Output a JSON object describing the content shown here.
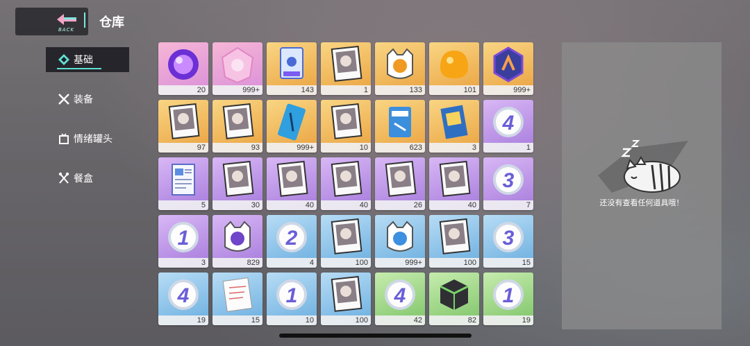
{
  "header": {
    "back_label": "BACK",
    "title": "仓库"
  },
  "sidebar": {
    "items": [
      {
        "label": "基础",
        "icon": "diamond-icon",
        "active": true
      },
      {
        "label": "装备",
        "icon": "crossed-swords-icon",
        "active": false
      },
      {
        "label": "情绪罐头",
        "icon": "tv-can-icon",
        "active": false
      },
      {
        "label": "餐盒",
        "icon": "fork-knife-icon",
        "active": false
      }
    ]
  },
  "items": [
    {
      "name": "purple-orb",
      "rarity": "pink",
      "count": "20"
    },
    {
      "name": "pink-crystal",
      "rarity": "pink",
      "count": "999+"
    },
    {
      "name": "paw-card",
      "rarity": "orange",
      "count": "143"
    },
    {
      "name": "portrait-card",
      "rarity": "orange",
      "count": "1"
    },
    {
      "name": "cat-capsule-orange",
      "rarity": "orange",
      "count": "133"
    },
    {
      "name": "amber-gem",
      "rarity": "orange",
      "count": "101"
    },
    {
      "name": "hex-badge",
      "rarity": "orange",
      "count": "999+"
    },
    {
      "name": "portrait-card",
      "rarity": "orange",
      "count": "97"
    },
    {
      "name": "portrait-card",
      "rarity": "orange",
      "count": "93"
    },
    {
      "name": "blue-card",
      "rarity": "orange",
      "count": "999+"
    },
    {
      "name": "portrait-card",
      "rarity": "orange",
      "count": "10"
    },
    {
      "name": "blue-ticket",
      "rarity": "orange",
      "count": "623"
    },
    {
      "name": "blue-book",
      "rarity": "orange",
      "count": "3"
    },
    {
      "name": "badge-4",
      "rarity": "purple",
      "count": "1"
    },
    {
      "name": "document",
      "rarity": "purple",
      "count": "5"
    },
    {
      "name": "portrait-card",
      "rarity": "purple",
      "count": "30"
    },
    {
      "name": "portrait-card",
      "rarity": "purple",
      "count": "40"
    },
    {
      "name": "portrait-card",
      "rarity": "purple",
      "count": "40"
    },
    {
      "name": "portrait-card",
      "rarity": "purple",
      "count": "26"
    },
    {
      "name": "portrait-card",
      "rarity": "purple",
      "count": "40"
    },
    {
      "name": "badge-3",
      "rarity": "purple",
      "count": "7"
    },
    {
      "name": "badge-1",
      "rarity": "purple",
      "count": "3"
    },
    {
      "name": "cat-capsule-purple",
      "rarity": "purple",
      "count": "829"
    },
    {
      "name": "badge-2",
      "rarity": "blue",
      "count": "4"
    },
    {
      "name": "portrait-card",
      "rarity": "blue",
      "count": "100"
    },
    {
      "name": "cat-capsule-blue",
      "rarity": "blue",
      "count": "999+"
    },
    {
      "name": "portrait-card",
      "rarity": "blue",
      "count": "100"
    },
    {
      "name": "badge-3",
      "rarity": "blue",
      "count": "15"
    },
    {
      "name": "badge-4",
      "rarity": "blue",
      "count": "19"
    },
    {
      "name": "paper-note",
      "rarity": "blue",
      "count": "15"
    },
    {
      "name": "badge-1",
      "rarity": "blue",
      "count": "10"
    },
    {
      "name": "portrait-card",
      "rarity": "blue",
      "count": "100"
    },
    {
      "name": "badge-4",
      "rarity": "green",
      "count": "42"
    },
    {
      "name": "green-box",
      "rarity": "green",
      "count": "82"
    },
    {
      "name": "badge-1",
      "rarity": "green",
      "count": "19"
    }
  ],
  "detail": {
    "empty_text": "还没有查看任何道具哦！",
    "icon": "sleeping-cat-icon"
  },
  "colors": {
    "accent": "#5fe0d6"
  }
}
